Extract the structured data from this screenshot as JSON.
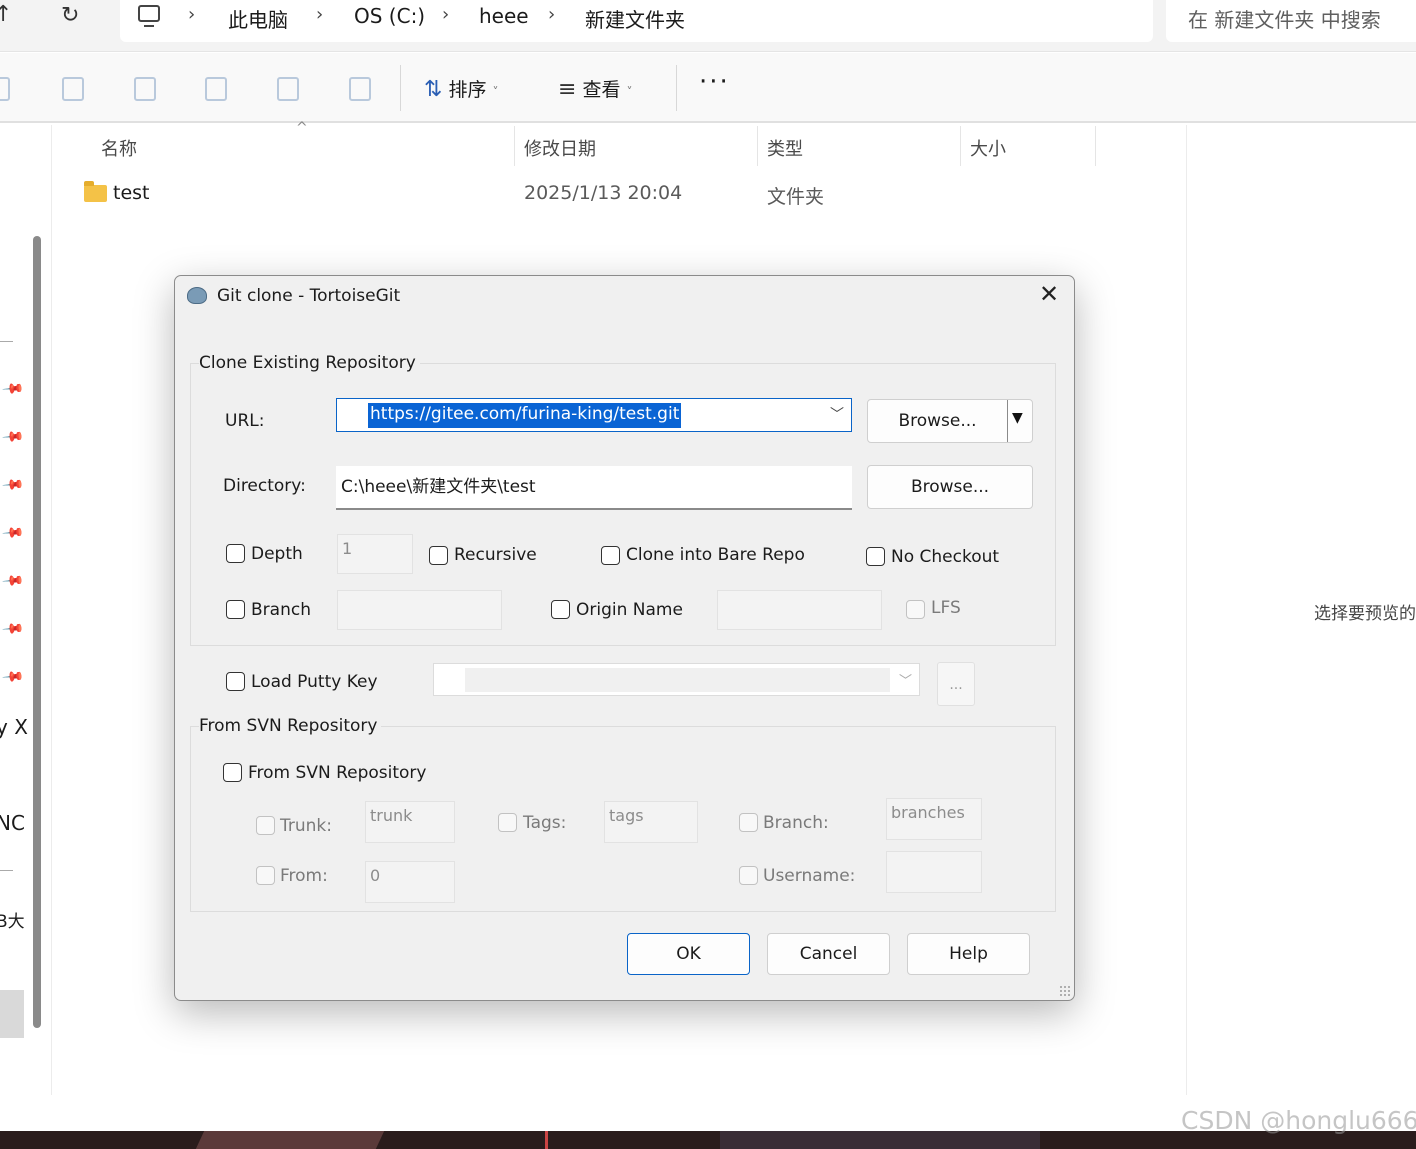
{
  "explorer": {
    "breadcrumb": [
      "此电脑",
      "OS (C:)",
      "heee",
      "新建文件夹"
    ],
    "search_placeholder": "在 新建文件夹 中搜索",
    "toolbar": {
      "sort_label": "排序",
      "view_label": "查看",
      "more_label": "···"
    },
    "columns": [
      "名称",
      "修改日期",
      "类型",
      "大小"
    ],
    "files": [
      {
        "name": "test",
        "modified": "2025/1/13 20:04",
        "type": "文件夹",
        "size": ""
      }
    ],
    "preview_text": "选择要预览的",
    "left_pane_fragments": [
      "y X",
      "NC",
      "B大"
    ]
  },
  "dialog": {
    "title": "Git clone - TortoiseGit",
    "clone_group_label": "Clone Existing Repository",
    "url_label": "URL:",
    "url_value": "https://gitee.com/furina-king/test.git",
    "url_browse_label": "Browse...",
    "directory_label": "Directory:",
    "directory_value": "C:\\heee\\新建文件夹\\test",
    "directory_browse_label": "Browse...",
    "options": {
      "depth_label": "Depth",
      "depth_value": "1",
      "recursive_label": "Recursive",
      "bare_label": "Clone into Bare Repo",
      "no_checkout_label": "No Checkout",
      "branch_label": "Branch",
      "origin_label": "Origin Name",
      "lfs_label": "LFS"
    },
    "putty_label": "Load Putty Key",
    "putty_button_label": "...",
    "svn_group_label": "From SVN Repository",
    "svn": {
      "checkbox_label": "From SVN Repository",
      "trunk_label": "Trunk:",
      "trunk_value": "trunk",
      "tags_label": "Tags:",
      "tags_value": "tags",
      "branch_label": "Branch:",
      "branch_value": "branches",
      "from_label": "From:",
      "from_value": "0",
      "username_label": "Username:",
      "username_value": ""
    },
    "buttons": {
      "ok": "OK",
      "cancel": "Cancel",
      "help": "Help"
    }
  },
  "watermark": "CSDN @honglu666"
}
